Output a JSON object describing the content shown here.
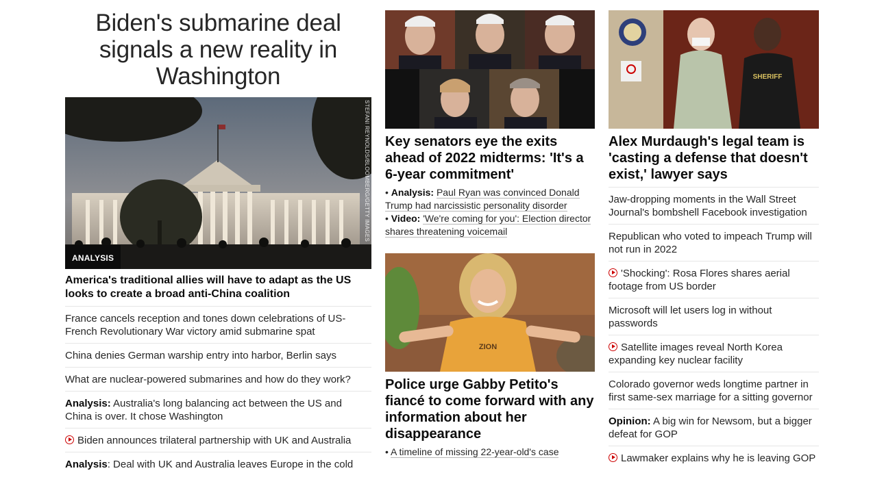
{
  "col1": {
    "headline": "Biden's submarine deal signals a new reality in Washington",
    "badge": "ANALYSIS",
    "photo_credit": "STEFANI REYNOLDS/BLOOMBERG/GETTY IMAGES",
    "lead_link": "America's traditional allies will have to adapt as the US looks to create a broad anti-China coalition",
    "items": [
      {
        "prefix": "",
        "text": "France cancels reception and tones down celebrations of US-French Revolutionary War victory amid submarine spat",
        "video": false
      },
      {
        "prefix": "",
        "text": "China denies German warship entry into harbor, Berlin says",
        "video": false
      },
      {
        "prefix": "",
        "text": "What are nuclear-powered submarines and how do they work?",
        "video": false
      },
      {
        "prefix": "Analysis:",
        "text": " Australia's long balancing act between the US and China is over. It chose Washington",
        "video": false
      },
      {
        "prefix": "",
        "text": "Biden announces trilateral partnership with UK and Australia",
        "video": true
      },
      {
        "prefix": "Analysis",
        "text": ": Deal with UK and Australia leaves Europe in the cold",
        "video": false
      }
    ]
  },
  "col2": {
    "story1": {
      "headline": "Key senators eye the exits ahead of 2022 midterms: 'It's a 6-year commitment'",
      "sublinks": [
        {
          "prefix": "Analysis:",
          "text": "Paul Ryan was convinced Donald Trump had narcissistic personality disorder"
        },
        {
          "prefix": "Video:",
          "text": "'We're coming for you': Election director shares threatening voicemail"
        }
      ]
    },
    "story2": {
      "headline": "Police urge Gabby Petito's fiancé to come forward with any information about her disappearance",
      "shirt_text": "ZION",
      "sublinks": [
        {
          "prefix": "",
          "text": "A timeline of missing 22-year-old's case"
        }
      ]
    }
  },
  "col3": {
    "headline": "Alex Murdaugh's legal team is 'casting a defense that doesn't exist,' lawyer says",
    "vest_text": "SHERIFF",
    "items": [
      {
        "prefix": "",
        "text": "Jaw-dropping moments in the Wall Street Journal's bombshell Facebook investigation",
        "video": false
      },
      {
        "prefix": "",
        "text": "Republican who voted to impeach Trump will not run in 2022",
        "video": false
      },
      {
        "prefix": "",
        "text": "'Shocking': Rosa Flores shares aerial footage from US border",
        "video": true
      },
      {
        "prefix": "",
        "text": "Microsoft will let users log in without passwords",
        "video": false
      },
      {
        "prefix": "",
        "text": "Satellite images reveal North Korea expanding key nuclear facility",
        "video": true
      },
      {
        "prefix": "",
        "text": "Colorado governor weds longtime partner in first same-sex marriage for a sitting governor",
        "video": false
      },
      {
        "prefix": "Opinion:",
        "text": " A big win for Newsom, but a bigger defeat for GOP",
        "video": false
      },
      {
        "prefix": "",
        "text": "Lawmaker explains why he is leaving GOP",
        "video": true
      }
    ]
  },
  "colors": {
    "video_icon": "#cc0000",
    "divider": "#e6e6e6",
    "badge_bg": "#0c0c0c"
  }
}
